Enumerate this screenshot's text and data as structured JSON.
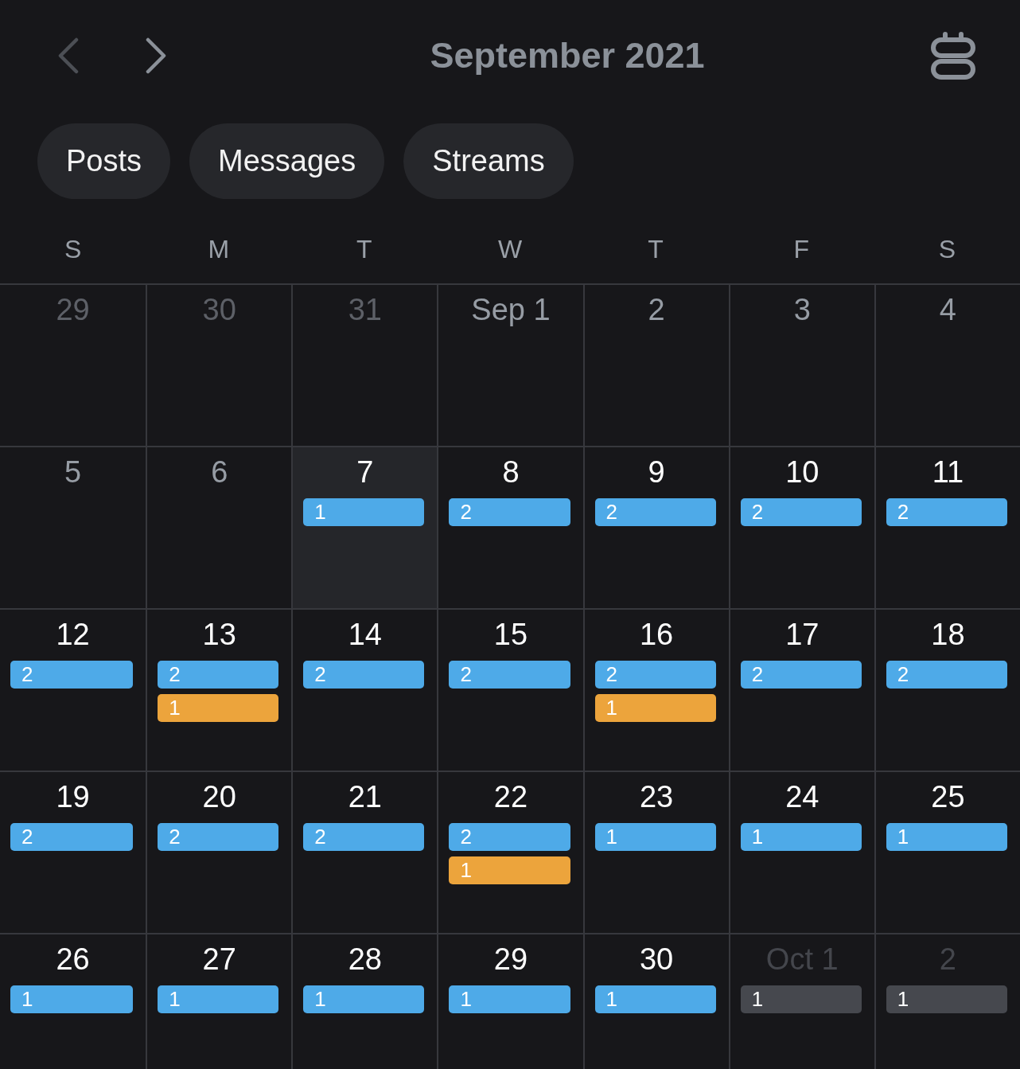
{
  "nav": {
    "previous": {
      "disabled": true
    },
    "next": {
      "disabled": false
    }
  },
  "header": {
    "title": "September 2021"
  },
  "filters": [
    {
      "label": "Posts"
    },
    {
      "label": "Messages"
    },
    {
      "label": "Streams"
    }
  ],
  "weekdays": [
    "S",
    "M",
    "T",
    "W",
    "T",
    "F",
    "S"
  ],
  "weeks": [
    {
      "days": [
        {
          "date": "29",
          "kind": "previous"
        },
        {
          "date": "30",
          "kind": "previous"
        },
        {
          "date": "31",
          "kind": "previous"
        },
        {
          "date": "Sep 1",
          "kind": "past"
        },
        {
          "date": "2",
          "kind": "past"
        },
        {
          "date": "3",
          "kind": "past"
        },
        {
          "date": "4",
          "kind": "past"
        }
      ]
    },
    {
      "days": [
        {
          "date": "5",
          "kind": "past"
        },
        {
          "date": "6",
          "kind": "past"
        },
        {
          "date": "7",
          "kind": "today",
          "events": [
            {
              "count": "1",
              "color": "#4eaae8"
            }
          ]
        },
        {
          "date": "8",
          "kind": "future",
          "events": [
            {
              "count": "2",
              "color": "#4eaae8"
            }
          ]
        },
        {
          "date": "9",
          "kind": "future",
          "events": [
            {
              "count": "2",
              "color": "#4eaae8"
            }
          ]
        },
        {
          "date": "10",
          "kind": "future",
          "events": [
            {
              "count": "2",
              "color": "#4eaae8"
            }
          ]
        },
        {
          "date": "11",
          "kind": "future",
          "events": [
            {
              "count": "2",
              "color": "#4eaae8"
            }
          ]
        }
      ]
    },
    {
      "days": [
        {
          "date": "12",
          "kind": "future",
          "events": [
            {
              "count": "2",
              "color": "#4eaae8"
            }
          ]
        },
        {
          "date": "13",
          "kind": "future",
          "events": [
            {
              "count": "2",
              "color": "#4eaae8"
            },
            {
              "count": "1",
              "color": "#eca43c"
            }
          ]
        },
        {
          "date": "14",
          "kind": "future",
          "events": [
            {
              "count": "2",
              "color": "#4eaae8"
            }
          ]
        },
        {
          "date": "15",
          "kind": "future",
          "events": [
            {
              "count": "2",
              "color": "#4eaae8"
            }
          ]
        },
        {
          "date": "16",
          "kind": "future",
          "events": [
            {
              "count": "2",
              "color": "#4eaae8"
            },
            {
              "count": "1",
              "color": "#eca43c"
            }
          ]
        },
        {
          "date": "17",
          "kind": "future",
          "events": [
            {
              "count": "2",
              "color": "#4eaae8"
            }
          ]
        },
        {
          "date": "18",
          "kind": "future",
          "events": [
            {
              "count": "2",
              "color": "#4eaae8"
            }
          ]
        }
      ]
    },
    {
      "days": [
        {
          "date": "19",
          "kind": "future",
          "events": [
            {
              "count": "2",
              "color": "#4eaae8"
            }
          ]
        },
        {
          "date": "20",
          "kind": "future",
          "events": [
            {
              "count": "2",
              "color": "#4eaae8"
            }
          ]
        },
        {
          "date": "21",
          "kind": "future",
          "events": [
            {
              "count": "2",
              "color": "#4eaae8"
            }
          ]
        },
        {
          "date": "22",
          "kind": "future",
          "events": [
            {
              "count": "2",
              "color": "#4eaae8"
            },
            {
              "count": "1",
              "color": "#eca43c"
            }
          ]
        },
        {
          "date": "23",
          "kind": "future",
          "events": [
            {
              "count": "1",
              "color": "#4eaae8"
            }
          ]
        },
        {
          "date": "24",
          "kind": "future",
          "events": [
            {
              "count": "1",
              "color": "#4eaae8"
            }
          ]
        },
        {
          "date": "25",
          "kind": "future",
          "events": [
            {
              "count": "1",
              "color": "#4eaae8"
            }
          ]
        }
      ]
    },
    {
      "days": [
        {
          "date": "26",
          "kind": "future",
          "events": [
            {
              "count": "1",
              "color": "#4eaae8"
            }
          ]
        },
        {
          "date": "27",
          "kind": "future",
          "events": [
            {
              "count": "1",
              "color": "#4eaae8"
            }
          ]
        },
        {
          "date": "28",
          "kind": "future",
          "events": [
            {
              "count": "1",
              "color": "#4eaae8"
            }
          ]
        },
        {
          "date": "29",
          "kind": "future",
          "events": [
            {
              "count": "1",
              "color": "#4eaae8"
            }
          ]
        },
        {
          "date": "30",
          "kind": "future",
          "events": [
            {
              "count": "1",
              "color": "#4eaae8"
            }
          ]
        },
        {
          "date": "Oct 1",
          "kind": "next",
          "events": [
            {
              "count": "1",
              "color": "#46484e"
            }
          ]
        },
        {
          "date": "2",
          "kind": "next",
          "events": [
            {
              "count": "1",
              "color": "#46484e"
            }
          ]
        }
      ]
    }
  ]
}
